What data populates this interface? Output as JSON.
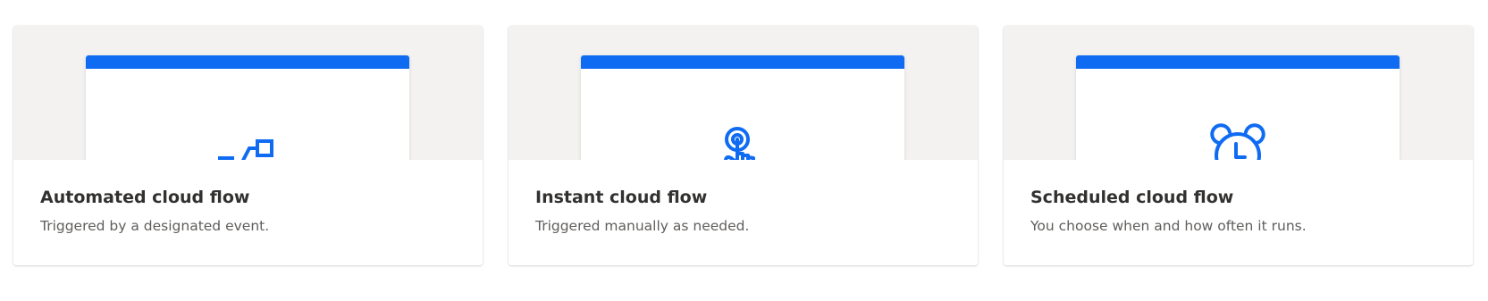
{
  "cards": [
    {
      "title": "Automated cloud flow",
      "description": "Triggered by a designated event.",
      "icon": "automated-flow-icon"
    },
    {
      "title": "Instant cloud flow",
      "description": "Triggered manually as needed.",
      "icon": "touch-hand-icon"
    },
    {
      "title": "Scheduled cloud flow",
      "description": "You choose when and how often it runs.",
      "icon": "alarm-clock-icon"
    }
  ],
  "colors": {
    "accent": "#0f6cf2",
    "illustration_bg": "#f3f2f1",
    "title_text": "#323130",
    "description_text": "#605e5c"
  }
}
